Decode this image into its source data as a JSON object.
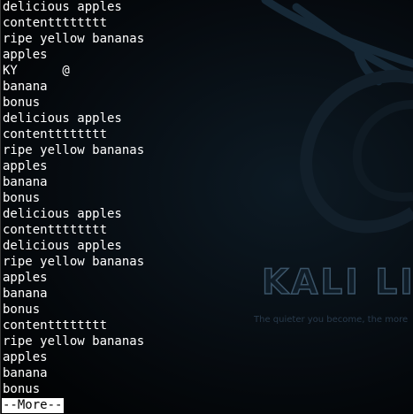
{
  "wallpaper": {
    "logo_text": "KALI LI",
    "tagline": "The quieter you become, the more",
    "colors": {
      "background": "#000000",
      "dragon_outline": "#162836",
      "logo_stroke": "#3b5468"
    }
  },
  "terminal": {
    "text_color": "#ffffff",
    "lines": [
      "delicious apples",
      "contentttttttt",
      "ripe yellow bananas",
      "apples",
      "KY      @",
      "banana",
      "bonus",
      "delicious apples",
      "contentttttttt",
      "ripe yellow bananas",
      "apples",
      "banana",
      "bonus",
      "delicious apples",
      "contentttttttt",
      "delicious apples",
      "ripe yellow bananas",
      "apples",
      "banana",
      "bonus",
      "contentttttttt",
      "ripe yellow bananas",
      "apples",
      "banana",
      "bonus"
    ],
    "pager_prompt": "--More--"
  }
}
